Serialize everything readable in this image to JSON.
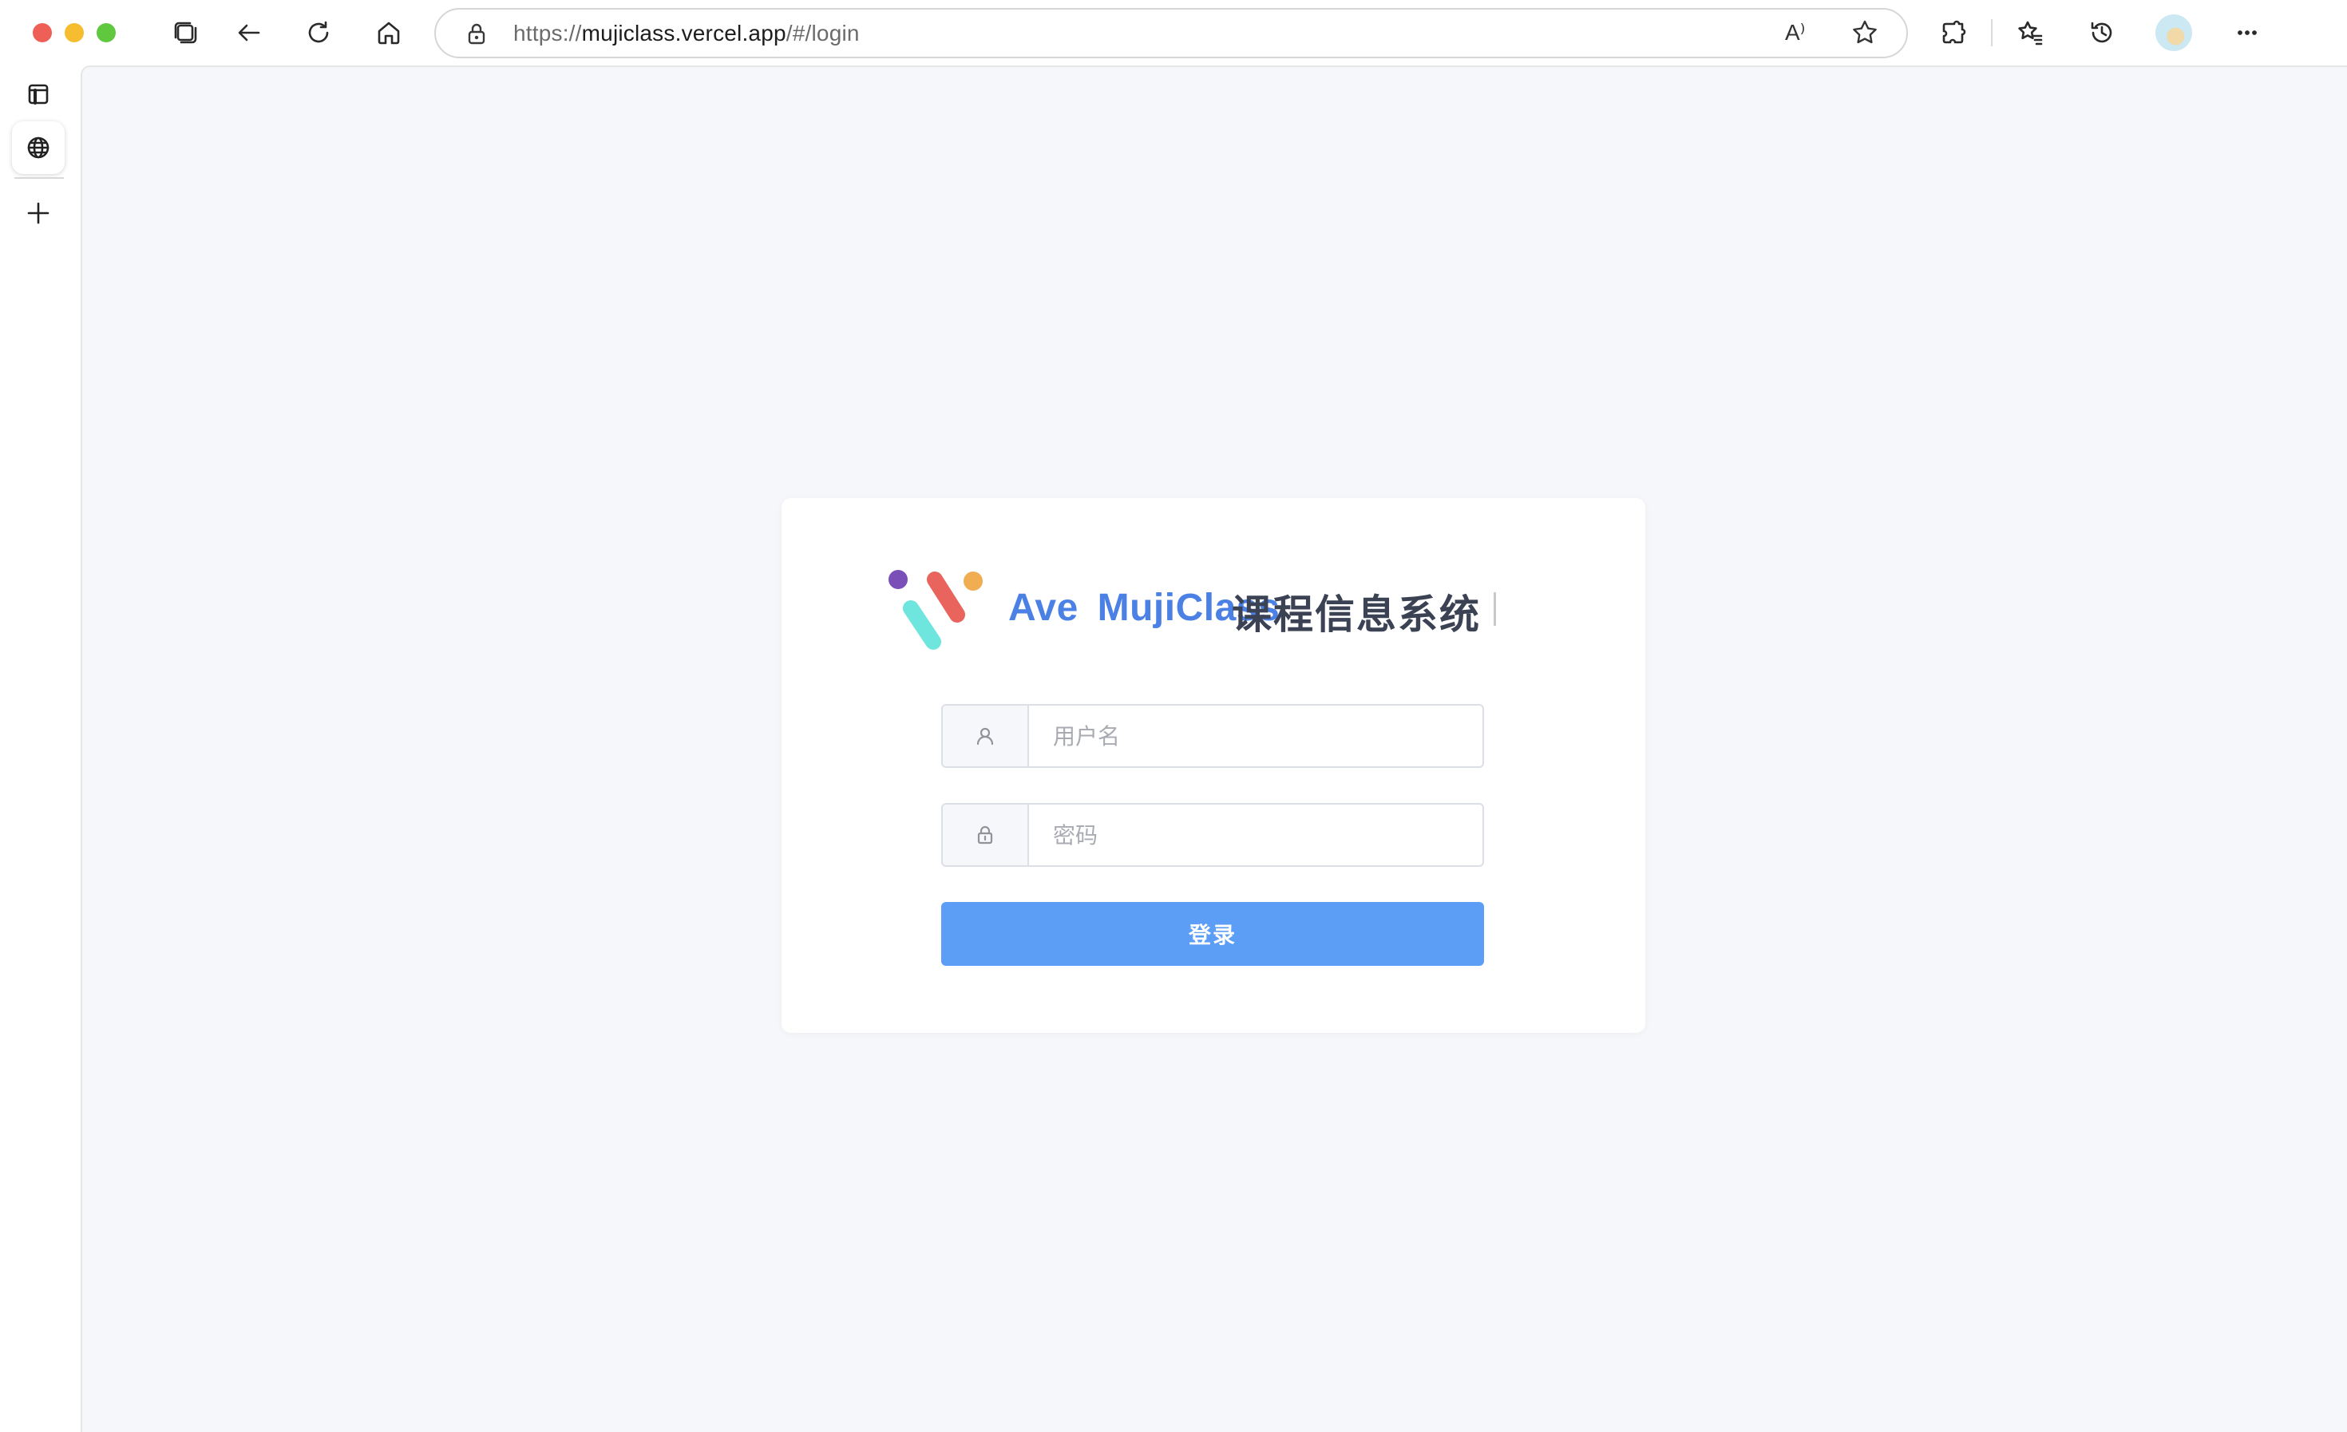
{
  "browser": {
    "url_scheme": "https://",
    "url_host": "mujiclass.vercel.app",
    "url_path": "/#/login",
    "read_aloud_glyph": "A⁾",
    "toolbar_icons": [
      "tabs-icon",
      "back-arrow-icon",
      "refresh-icon",
      "home-icon",
      "lock-icon",
      "read-aloud-icon",
      "favorite-star-icon",
      "extensions-icon",
      "favorites-icon",
      "history-icon",
      "profile-avatar",
      "more-menu-icon"
    ],
    "sidebar_icons": [
      "sidebar-panel-icon",
      "globe-icon",
      "new-tab-plus-icon"
    ]
  },
  "login": {
    "brand_name": "Ave  MujiClass",
    "system_title": "课程信息系统",
    "username_placeholder": "用户名",
    "password_placeholder": "密码",
    "login_button": "登录"
  },
  "colors": {
    "brand_blue": "#4b80e5",
    "button_blue": "#5c9df5",
    "page_background": "#f6f7fa",
    "logo_purple": "#7b4fb8",
    "logo_red": "#e8645c",
    "logo_orange": "#f0ad52",
    "logo_cyan": "#6ee6de"
  }
}
